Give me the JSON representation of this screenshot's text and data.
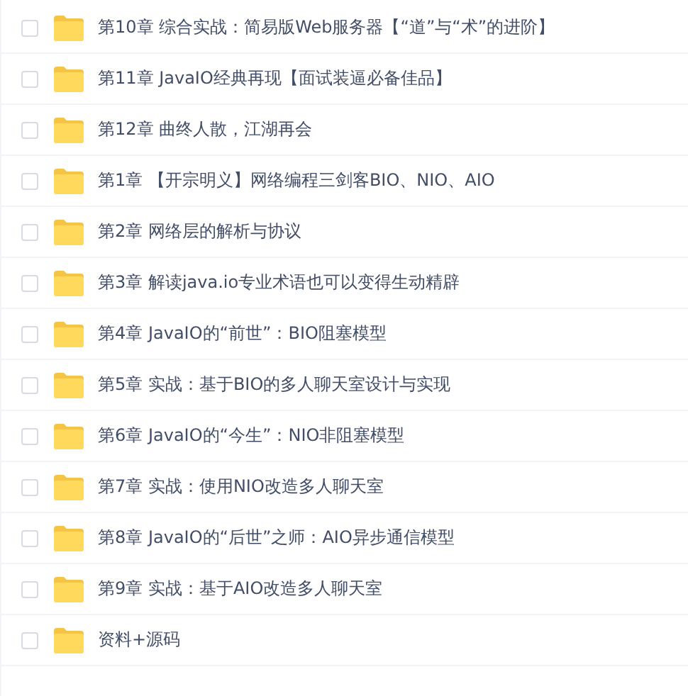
{
  "files": [
    {
      "name": "第10章 综合实战：简易版Web服务器【“道”与“术”的进阶】",
      "checked": false
    },
    {
      "name": "第11章 JavaIO经典再现【面试装逼必备佳品】",
      "checked": false
    },
    {
      "name": "第12章 曲终人散，江湖再会",
      "checked": false
    },
    {
      "name": "第1章 【开宗明义】网络编程三剑客BIO、NIO、AIO",
      "checked": false
    },
    {
      "name": "第2章 网络层的解析与协议",
      "checked": false
    },
    {
      "name": "第3章 解读java.io专业术语也可以变得生动精辟",
      "checked": false
    },
    {
      "name": "第4章 JavaIO的“前世”：BIO阻塞模型",
      "checked": false
    },
    {
      "name": "第5章 实战：基于BIO的多人聊天室设计与实现",
      "checked": false
    },
    {
      "name": "第6章 JavaIO的“今生”：NIO非阻塞模型",
      "checked": false
    },
    {
      "name": "第7章 实战：使用NIO改造多人聊天室",
      "checked": false
    },
    {
      "name": "第8章 JavaIO的“后世”之师：AIO异步通信模型",
      "checked": false
    },
    {
      "name": "第9章 实战：基于AIO改造多人聊天室",
      "checked": false
    },
    {
      "name": "资料+源码",
      "checked": false
    }
  ]
}
